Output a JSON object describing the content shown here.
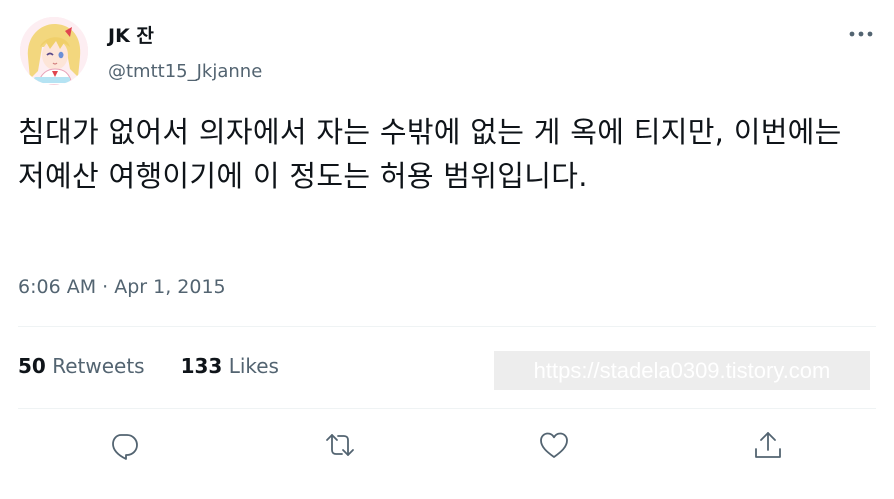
{
  "author": {
    "display_name": "JK 잔",
    "handle": "@tmtt15_Jkjanne",
    "avatar_icon": "anime-avatar"
  },
  "tweet": {
    "text": "침대가 없어서 의자에서 자는 수밖에 없는 게 옥에 티지만, 이번에는 저예산 여행이기에 이 정도는 허용 범위입니다.",
    "timestamp": "6:06 AM · Apr 1, 2015"
  },
  "stats": {
    "retweets_count": "50",
    "retweets_label": "Retweets",
    "likes_count": "133",
    "likes_label": "Likes"
  },
  "watermark": "https://stadela0309.tistory.com",
  "actions": [
    {
      "icon": "reply-icon"
    },
    {
      "icon": "retweet-icon"
    },
    {
      "icon": "like-icon"
    },
    {
      "icon": "share-icon"
    }
  ],
  "colors": {
    "text_primary": "#0f1419",
    "text_secondary": "#536471",
    "divider": "#eff3f4"
  }
}
